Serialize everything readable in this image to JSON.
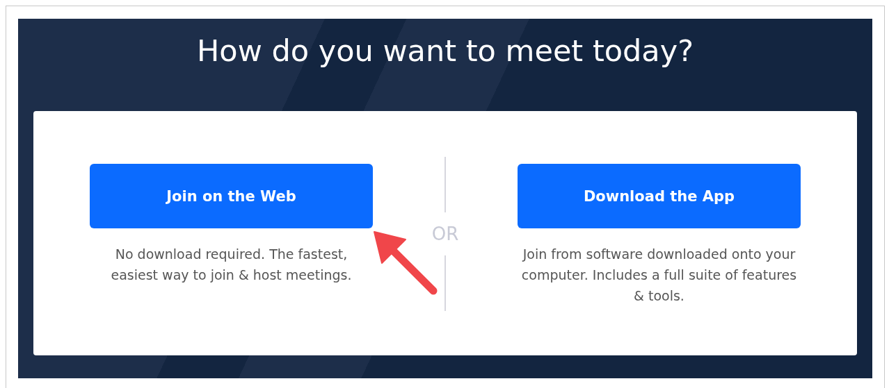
{
  "title": "How do you want to meet today?",
  "options": [
    {
      "label": "Join on the Web",
      "description": "No download required. The fastest, easiest way to join & host meetings."
    },
    {
      "label": "Download the App",
      "description": "Join from software downloaded onto your computer. Includes a full suite of features & tools."
    }
  ],
  "separator": "OR"
}
